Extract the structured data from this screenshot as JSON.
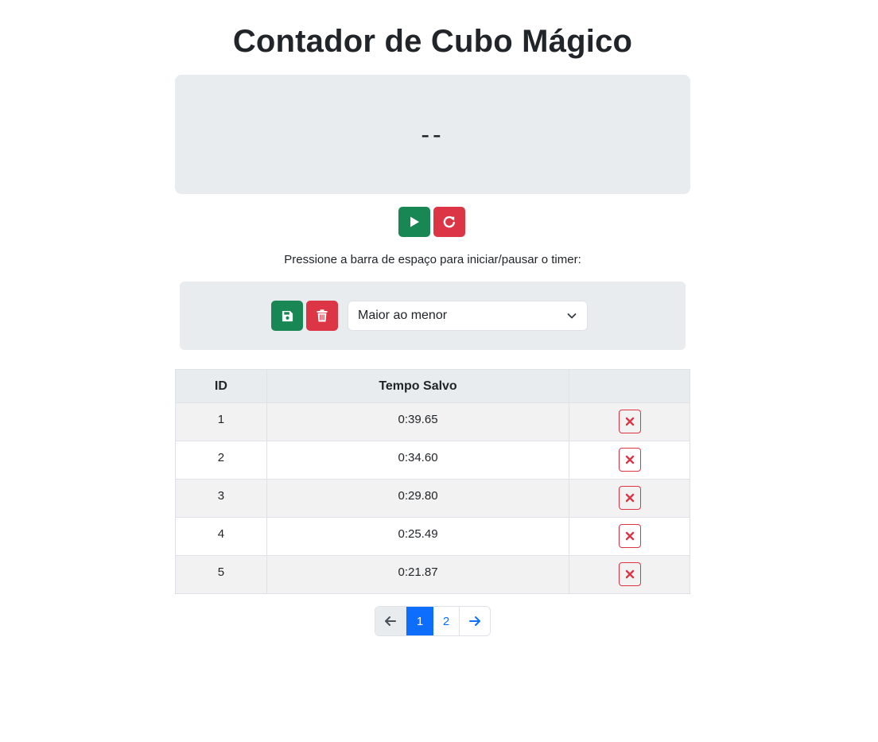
{
  "header": {
    "title": "Contador de Cubo Mágico"
  },
  "timer": {
    "display": "--"
  },
  "controls": {
    "play_icon": "play-icon",
    "reset_icon": "rotate-right-icon"
  },
  "hint": "Pressione a barra de espaço para iniciar/pausar o timer:",
  "toolbar": {
    "save_icon": "floppy-disk-icon",
    "trash_icon": "trash-icon",
    "sort_select": {
      "value": "Maior ao menor"
    }
  },
  "table": {
    "headers": [
      "ID",
      "Tempo Salvo",
      ""
    ],
    "rows": [
      {
        "id": "1",
        "time": "0:39.65"
      },
      {
        "id": "2",
        "time": "0:34.60"
      },
      {
        "id": "3",
        "time": "0:29.80"
      },
      {
        "id": "4",
        "time": "0:25.49"
      },
      {
        "id": "5",
        "time": "0:21.87"
      }
    ]
  },
  "pagination": {
    "pages": [
      "1",
      "2"
    ],
    "current_page": "1"
  },
  "colors": {
    "success": "#198754",
    "danger": "#dc3545",
    "primary": "#0d6efd",
    "panel": "#e9ecef"
  }
}
